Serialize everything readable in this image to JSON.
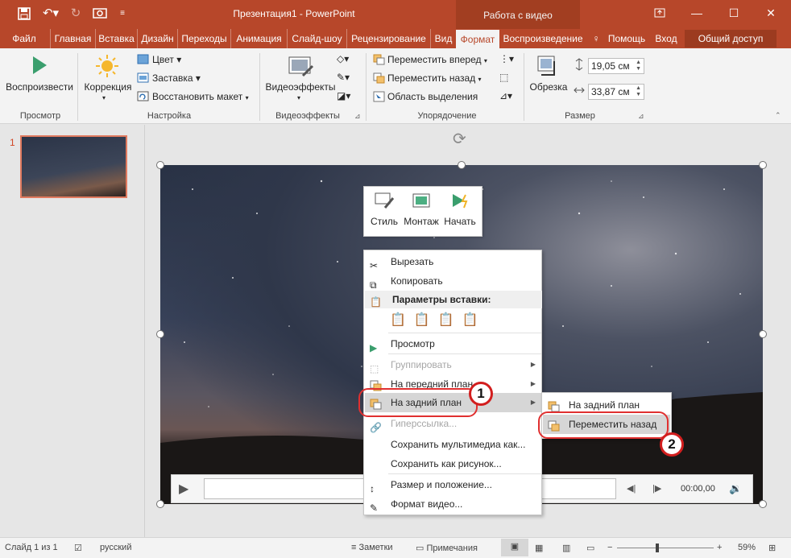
{
  "titlebar": {
    "doc_title": "Презентация1 - PowerPoint",
    "context_group": "Работа с видео",
    "icons": [
      "save-icon",
      "undo-icon",
      "redo-icon",
      "record-icon",
      "customize-qat-icon",
      "ribbon-display-icon",
      "minimize-icon",
      "maximize-icon",
      "close-icon"
    ]
  },
  "tabs": [
    {
      "label": "Файл"
    },
    {
      "label": "Главная"
    },
    {
      "label": "Вставка"
    },
    {
      "label": "Дизайн"
    },
    {
      "label": "Переходы"
    },
    {
      "label": "Анимация"
    },
    {
      "label": "Слайд-шоу"
    },
    {
      "label": "Рецензирование"
    },
    {
      "label": "Вид"
    },
    {
      "label": "Формат"
    },
    {
      "label": "Воспроизведение"
    },
    {
      "label": "Помощь"
    },
    {
      "label": "Вход"
    }
  ],
  "share_label": "Общий доступ",
  "ribbon": {
    "preview": {
      "play_label": "Воспроизвести",
      "group": "Просмотр"
    },
    "adjust": {
      "correction": "Коррекция",
      "color": "Цвет",
      "poster": "Заставка",
      "reset": "Восстановить макет",
      "group": "Настройка"
    },
    "styles": {
      "effects": "Видеоэффекты",
      "group": "Видеоэффекты"
    },
    "arrange": {
      "forward": "Переместить вперед",
      "backward": "Переместить назад",
      "selection": "Область выделения",
      "group": "Упорядочение"
    },
    "size": {
      "crop": "Обрезка",
      "height": "19,05 см",
      "width": "33,87 см",
      "group": "Размер"
    }
  },
  "slide_panel": {
    "number": "1"
  },
  "mini_toolbar": [
    {
      "label": "Стиль"
    },
    {
      "label": "Монтаж"
    },
    {
      "label": "Начать"
    }
  ],
  "context_menu": {
    "cut": "Вырезать",
    "copy": "Копировать",
    "paste_header": "Параметры вставки:",
    "preview": "Просмотр",
    "group": "Группировать",
    "bring_front": "На передний план",
    "send_back": "На задний план",
    "hyperlink": "Гиперссылка...",
    "save_media": "Сохранить мультимедиа как...",
    "save_picture": "Сохранить как рисунок...",
    "size_position": "Размер и положение...",
    "format_video": "Формат видео..."
  },
  "submenu": {
    "send_to_back": "На задний план",
    "send_backward": "Переместить назад"
  },
  "badges": {
    "one": "1",
    "two": "2"
  },
  "player": {
    "time": "00:00,00"
  },
  "status": {
    "slide": "Слайд 1 из 1",
    "language": "русский",
    "notes": "Заметки",
    "comments": "Примечания",
    "zoom": "59%"
  },
  "colors": {
    "accent": "#b7472a",
    "highlight": "#d6d6d6",
    "annotation": "#d21e1e"
  }
}
